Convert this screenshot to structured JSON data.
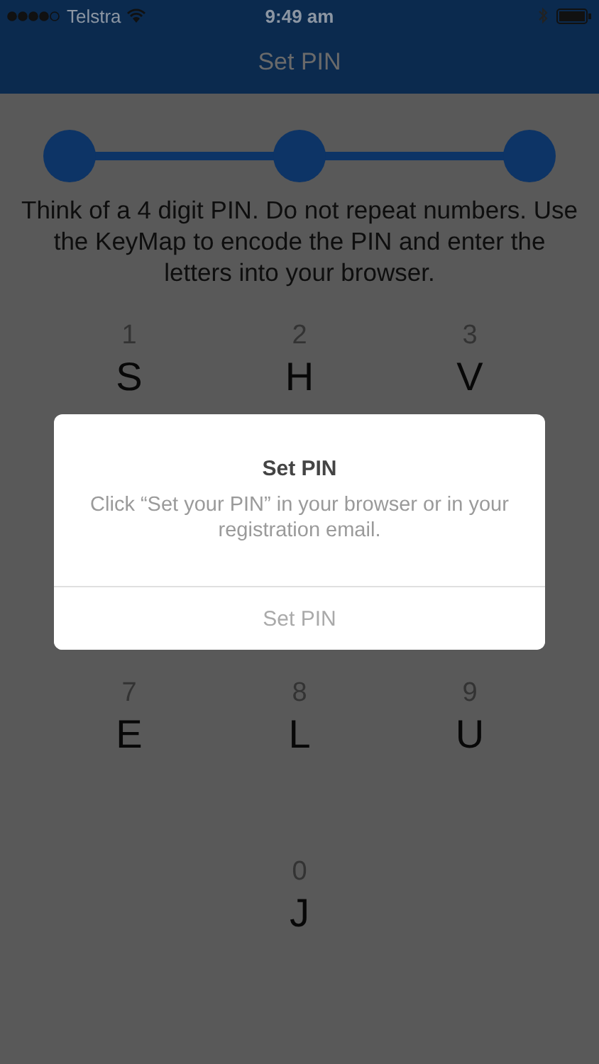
{
  "status_bar": {
    "carrier": "Telstra",
    "time": "9:49 am"
  },
  "nav": {
    "title": "Set PIN"
  },
  "instruction": "Think of a 4 digit PIN. Do not repeat numbers. Use the KeyMap to encode the PIN and enter the letters into your browser.",
  "keymap_rows": [
    [
      {
        "digit": "1",
        "letter": "S"
      },
      {
        "digit": "2",
        "letter": "H"
      },
      {
        "digit": "3",
        "letter": "V"
      }
    ],
    [],
    [
      {
        "digit": "7",
        "letter": "E"
      },
      {
        "digit": "8",
        "letter": "L"
      },
      {
        "digit": "9",
        "letter": "U"
      }
    ],
    [
      {
        "digit": "0",
        "letter": "J"
      }
    ]
  ],
  "dialog": {
    "title": "Set PIN",
    "message": "Click “Set your PIN” in your browser or in your registration email.",
    "button": "Set PIN"
  }
}
